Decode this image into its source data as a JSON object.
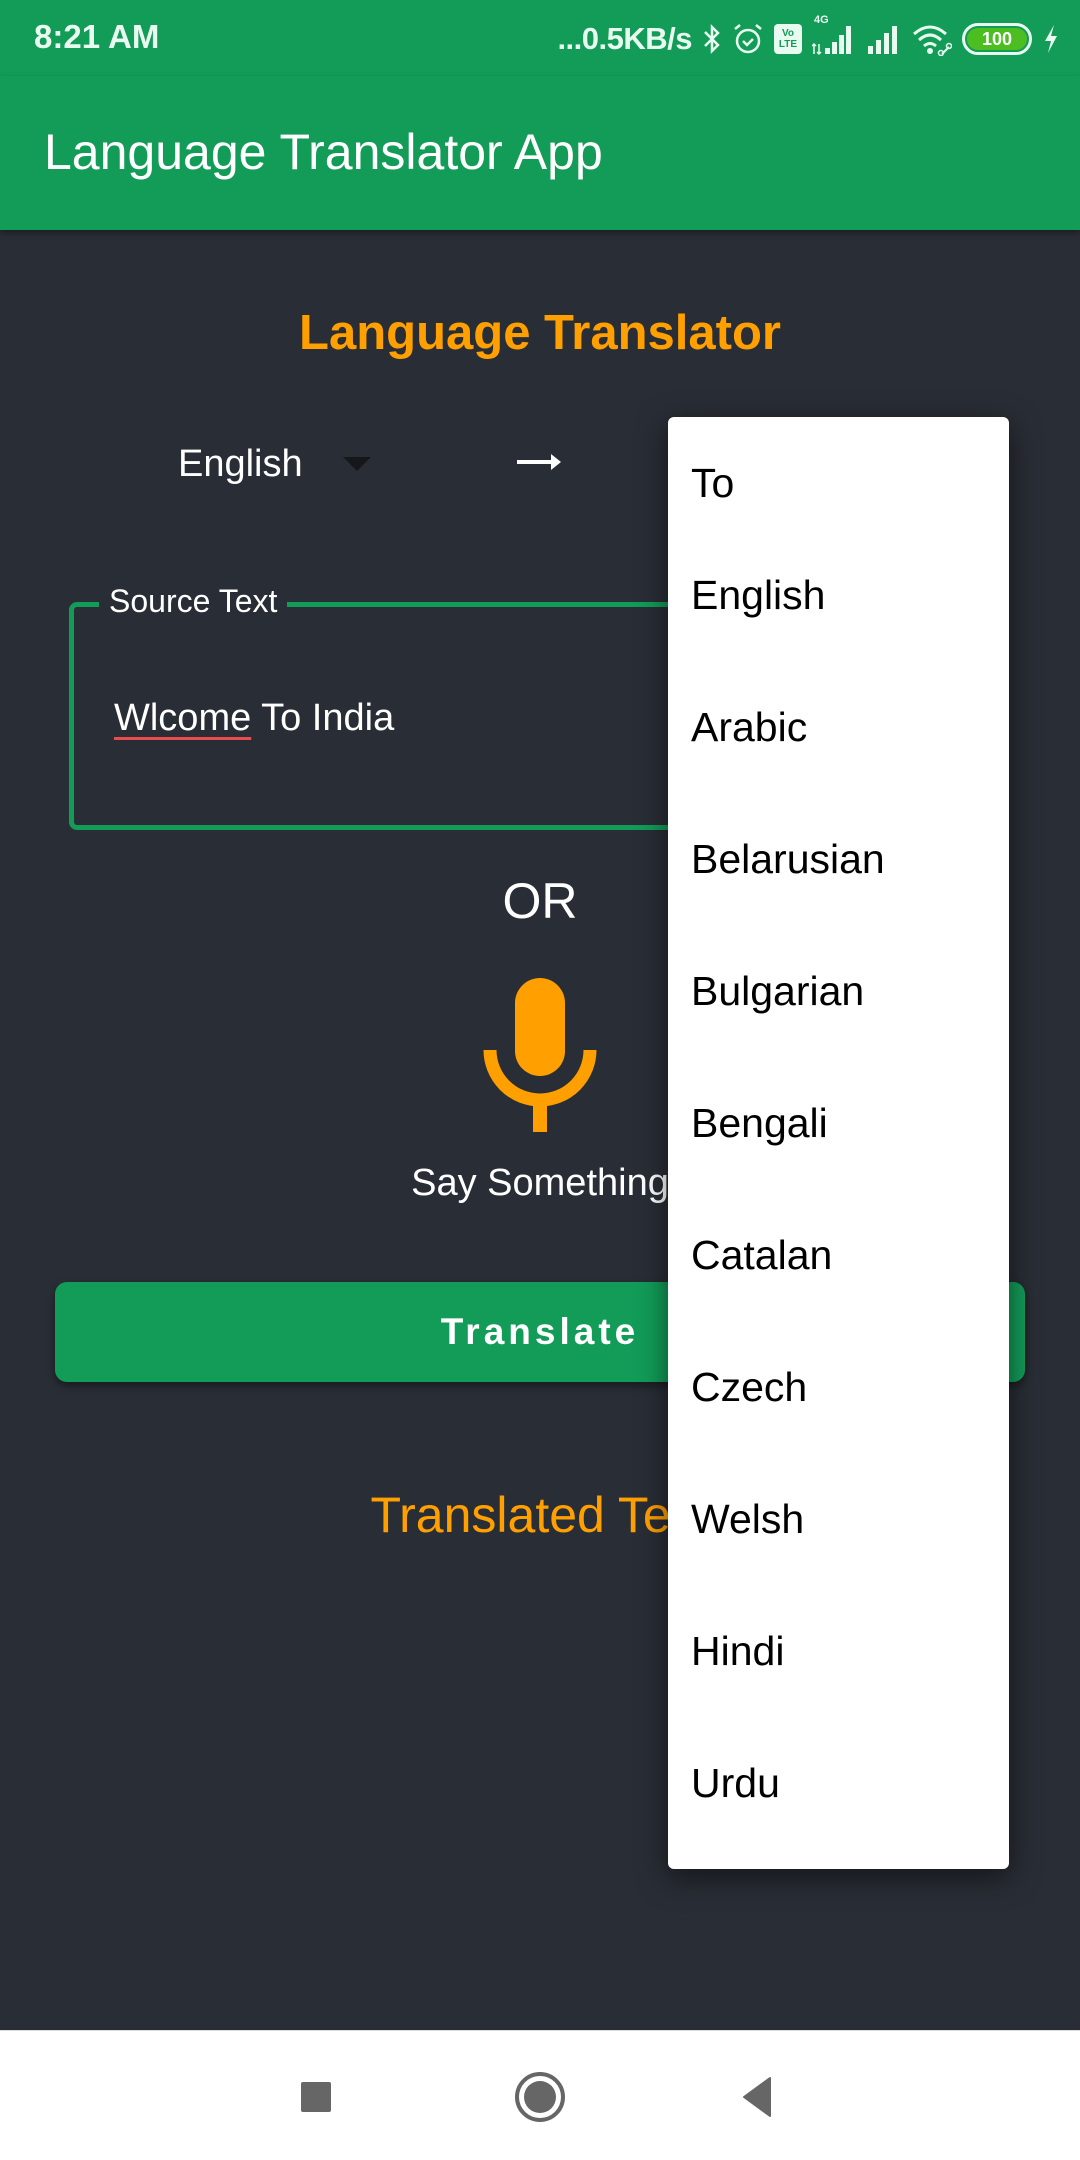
{
  "status_bar": {
    "time": "8:21 AM",
    "network_speed": "...0.5KB/s",
    "volte_label_top": "Vo",
    "volte_label_bottom": "LTE",
    "network_type": "4G",
    "battery_level": "100",
    "icons": [
      "bluetooth-icon",
      "alarm-icon",
      "volte-icon",
      "signal-4g-icon",
      "signal-icon",
      "wifi-icon",
      "battery-icon",
      "charging-icon"
    ]
  },
  "app_bar": {
    "title": "Language Translator App"
  },
  "main": {
    "heading": "Language Translator",
    "from_language": "English",
    "source_field": {
      "label": "Source Text",
      "value_misspelled": "Wlcome",
      "value_rest": " To India"
    },
    "or_text": "OR",
    "say_something": "Say Something",
    "translate_button": "Translate",
    "translated_text_label": "Translated Text"
  },
  "dropdown": {
    "items": [
      "To",
      "English",
      "Arabic",
      "Belarusian",
      "Bulgarian",
      "Bengali",
      "Catalan",
      "Czech",
      "Welsh",
      "Hindi",
      "Urdu"
    ]
  },
  "nav_bar": {
    "buttons": [
      "recents",
      "home",
      "back"
    ]
  },
  "colors": {
    "primary": "#129C58",
    "accent": "#FFA000",
    "background": "#292D35"
  }
}
